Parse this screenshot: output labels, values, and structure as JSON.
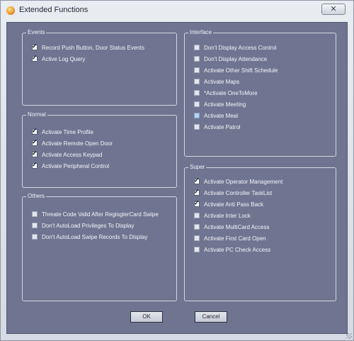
{
  "window": {
    "title": "Extended Functions",
    "close_glyph": "✕",
    "icons": {
      "app": "app-icon",
      "close": "close-icon",
      "resize": "resize-grip-icon"
    }
  },
  "groups": {
    "events": {
      "title": "Events",
      "items": [
        {
          "label": "Record Push Button, Door Status Events",
          "checked": true
        },
        {
          "label": "Active Log Query",
          "checked": true
        }
      ]
    },
    "normal": {
      "title": "Normal",
      "items": [
        {
          "label": "Activate Time Profile",
          "checked": true
        },
        {
          "label": "Activate Remote Open Door",
          "checked": true
        },
        {
          "label": "Activate Access Keypad",
          "checked": true
        },
        {
          "label": "Activate Peripheral Control",
          "checked": true
        }
      ]
    },
    "others": {
      "title": "Others",
      "items": [
        {
          "label": "Threate Code Valid After RegisgterCard Swipe",
          "checked": false
        },
        {
          "label": "Don't AutoLoad Privileges To Display",
          "checked": false
        },
        {
          "label": "Don't AutoLoad Swipe Records To Display",
          "checked": false
        }
      ]
    },
    "interface": {
      "title": "Interface",
      "items": [
        {
          "label": "Don't Display Access Control",
          "checked": false
        },
        {
          "label": "Don't Display Attendance",
          "checked": false
        },
        {
          "label": "Activate Other Shift Schedule",
          "checked": false
        },
        {
          "label": "Activate Maps",
          "checked": false
        },
        {
          "label": "*Activate OneToMore",
          "checked": false
        },
        {
          "label": "Activate Meeting",
          "checked": false
        },
        {
          "label": "Activate Meal",
          "checked": false,
          "hover": true
        },
        {
          "label": "Activate Patrol",
          "checked": false
        }
      ]
    },
    "super": {
      "title": "Super",
      "items": [
        {
          "label": "Activate Operator Management",
          "checked": true
        },
        {
          "label": "Activate Controller TaskList",
          "checked": true
        },
        {
          "label": "Activate Anti Pass Back",
          "checked": true
        },
        {
          "label": "Activate Inter Lock",
          "checked": false
        },
        {
          "label": "Activate MultiCard Access",
          "checked": false
        },
        {
          "label": "Activate First Card Open",
          "checked": false
        },
        {
          "label": "Activate PC Check Access",
          "checked": false
        }
      ]
    }
  },
  "buttons": {
    "ok": "OK",
    "cancel": "Cancel"
  }
}
